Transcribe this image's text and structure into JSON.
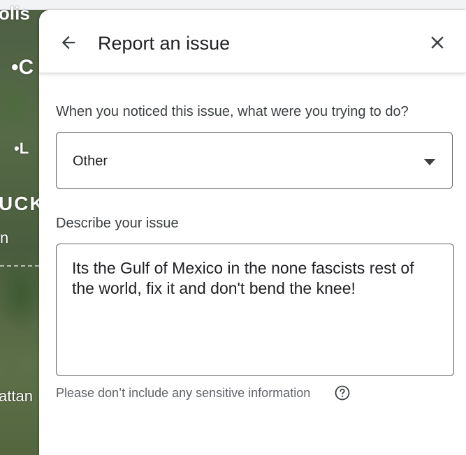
{
  "map": {
    "labels": [
      "olis",
      "•C",
      "•L",
      "UCK",
      "n",
      "attan"
    ]
  },
  "dialog": {
    "title": "Report an issue",
    "back_icon": "arrow-back-icon",
    "close_icon": "close-icon"
  },
  "form": {
    "question": "When you noticed this issue, what were you trying to do?",
    "selected_option": "Other",
    "describe_label": "Describe your issue",
    "description_value": "Its the Gulf of Mexico in the none fascists rest of the world, fix it and don't bend the knee!",
    "hint": "Please don’t include any sensitive information",
    "help_icon": "help-circle-icon"
  },
  "colors": {
    "text_primary": "#202124",
    "text_secondary": "#5f6368",
    "border": "#5f6368"
  }
}
